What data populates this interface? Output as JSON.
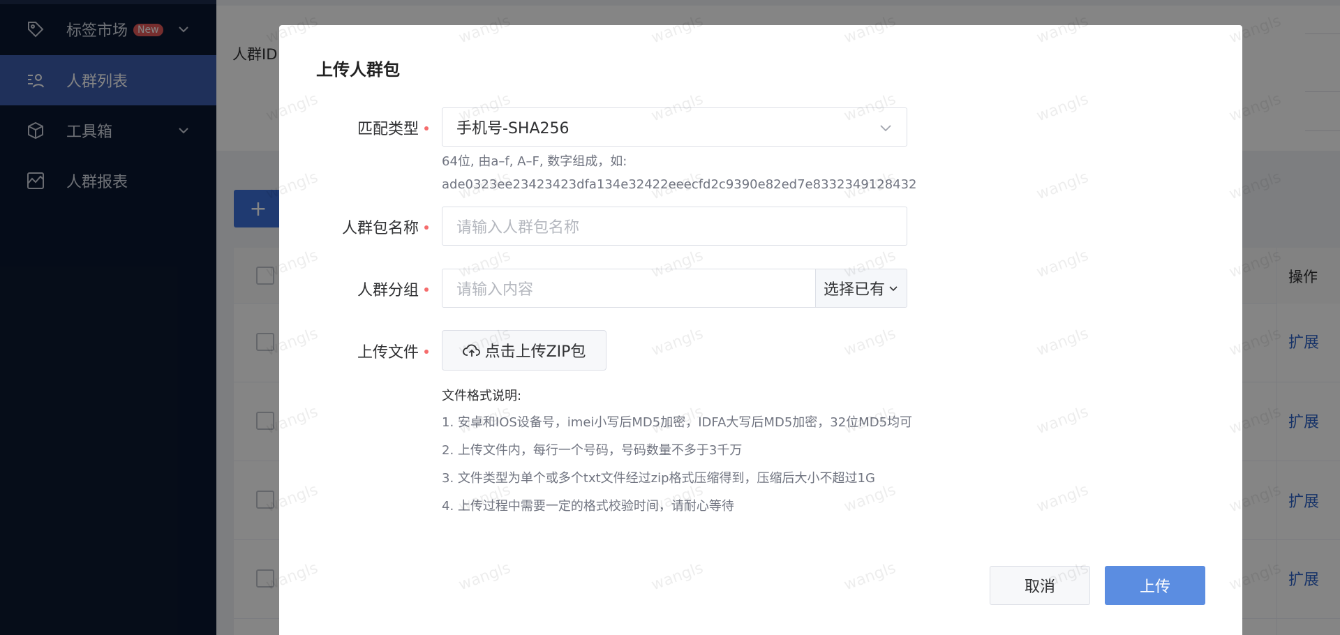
{
  "sidebar": {
    "items": [
      {
        "label": "标签市场",
        "badge": "New",
        "icon": "tag-icon",
        "has_chevron": true,
        "active": false
      },
      {
        "label": "人群列表",
        "icon": "crowd-list-icon",
        "has_chevron": false,
        "active": true
      },
      {
        "label": "工具箱",
        "icon": "box-icon",
        "has_chevron": true,
        "active": false
      },
      {
        "label": "人群报表",
        "icon": "chart-report-icon",
        "has_chevron": false,
        "active": false
      }
    ]
  },
  "background": {
    "filter_label": "人群ID",
    "add_button": "+",
    "table_ops_header": "操作",
    "row_action": "扩展",
    "rows": [
      "扩展",
      "扩展",
      "扩展",
      "扩展"
    ]
  },
  "modal": {
    "title": "上传人群包",
    "match_type": {
      "label": "匹配类型",
      "value": "手机号-SHA256",
      "hint_line1": "64位, 由a–f, A–F, 数字组成，如:",
      "hint_line2": "ade0323ee23423423dfa134e32422eeecfd2c9390e82ed7e8332349128432"
    },
    "package_name": {
      "label": "人群包名称",
      "placeholder": "请输入人群包名称"
    },
    "group": {
      "label": "人群分组",
      "placeholder": "请输入内容",
      "append_label": "选择已有"
    },
    "upload": {
      "label": "上传文件",
      "button_label": "点击上传ZIP包",
      "notes_title": "文件格式说明:",
      "notes": [
        "1. 安卓和IOS设备号，imei小写后MD5加密，IDFA大写后MD5加密，32位MD5均可",
        "2. 上传文件内，每行一个号码，号码数量不多于3千万",
        "3. 文件类型为单个或多个txt文件经过zip格式压缩得到，压缩后大小不超过1G",
        "4. 上传过程中需要一定的格式校验时间，请耐心等待"
      ]
    },
    "cancel_label": "取消",
    "submit_label": "上传"
  },
  "watermark": "wangls",
  "colors": {
    "sidebar_bg": "#0b1830",
    "sidebar_active": "#3c5cad",
    "primary": "#5b8de1",
    "link": "#2d63c8",
    "required": "#f56c6c",
    "badge": "#e25858"
  }
}
